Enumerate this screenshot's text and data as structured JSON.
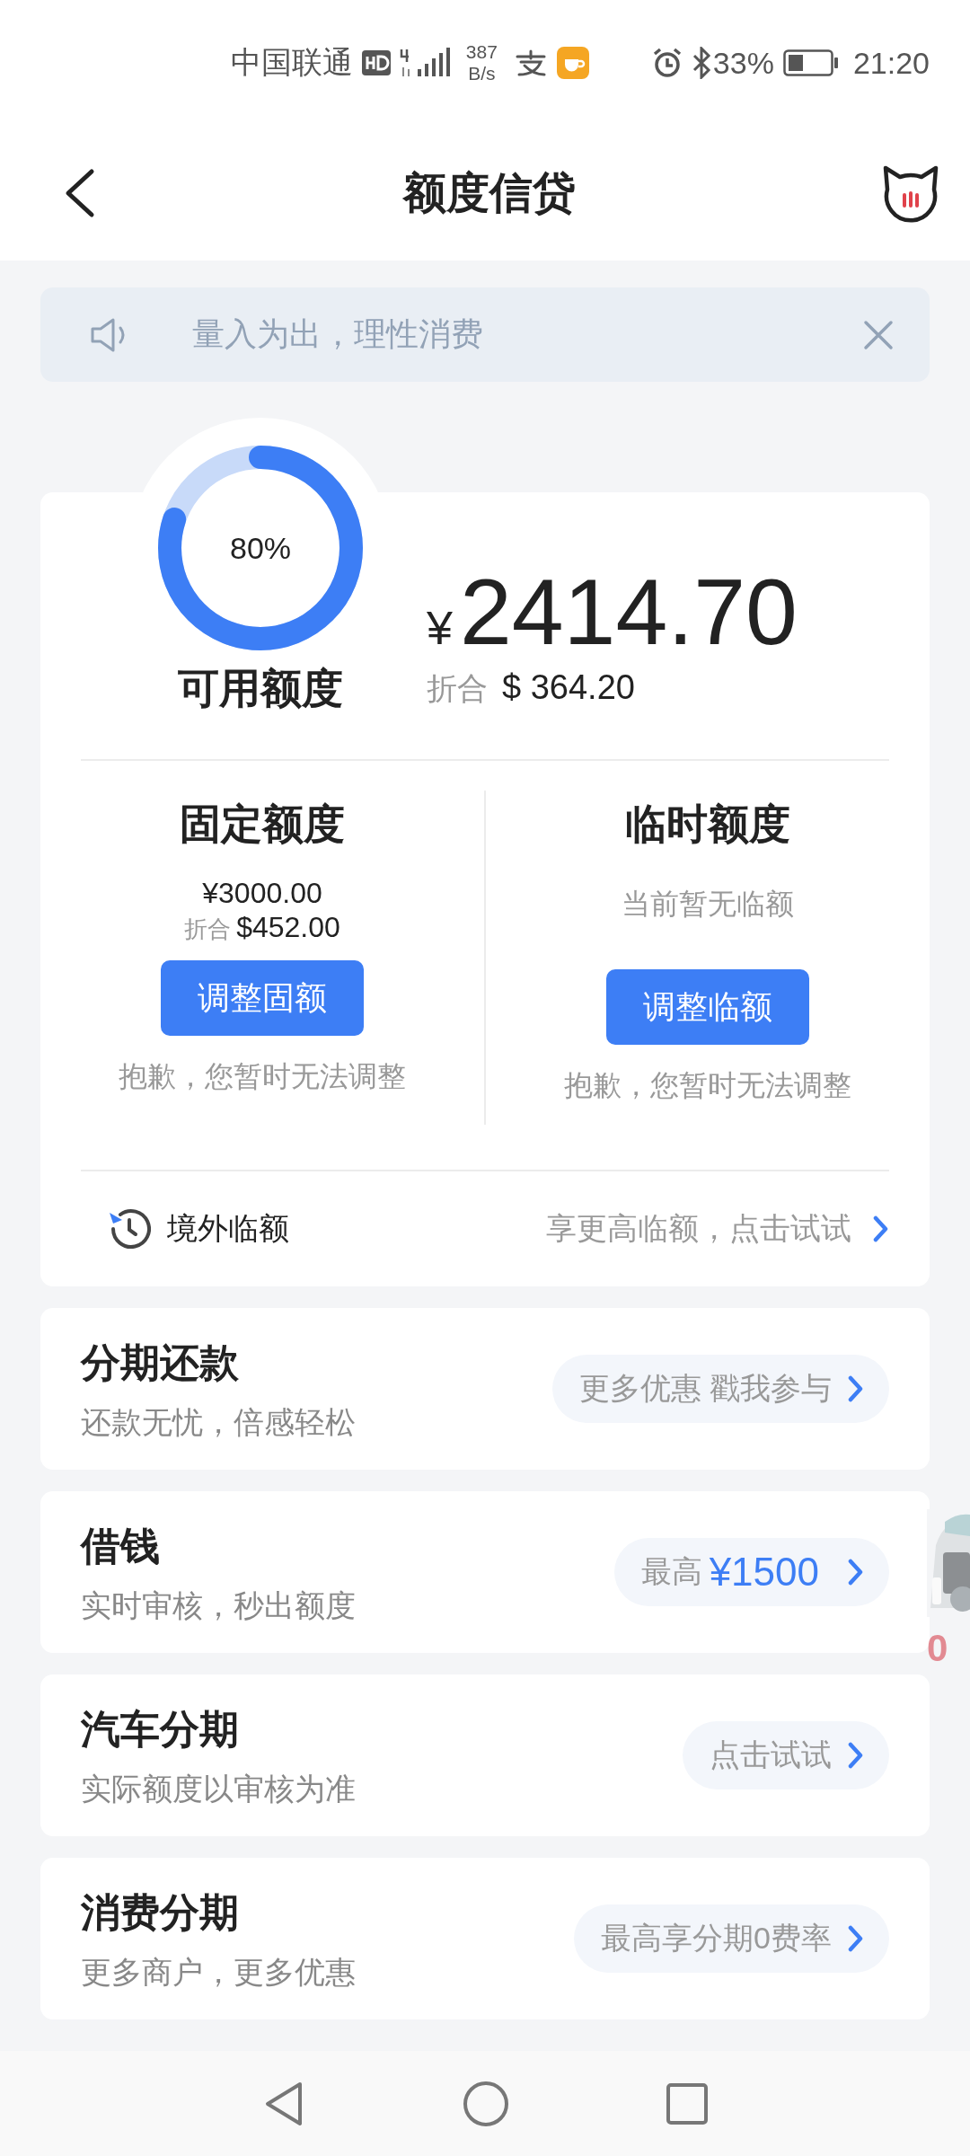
{
  "status_bar": {
    "carrier": "中国联通",
    "speed_value": "387",
    "speed_unit": "B/s",
    "battery": "33%",
    "time": "21:20"
  },
  "header": {
    "title": "额度信贷"
  },
  "notice": {
    "text": "量入为出，理性消费"
  },
  "credit": {
    "usage": "80%",
    "level": 0.8,
    "label": "可用额度",
    "currency": "¥",
    "amount": "2414.70",
    "converted_label": "折合",
    "converted_amount": "$ 364.20",
    "limits": [
      {
        "title": "固定额度",
        "amount": "¥3000.00",
        "converted_label": "折合",
        "converted_amount": "$452.00",
        "button": "调整固额",
        "note": "抱歉，您暂时无法调整"
      },
      {
        "title": "临时额度",
        "status": "当前暂无临额",
        "button": "调整临额",
        "note": "抱歉，您暂时无法调整"
      }
    ],
    "overseas": {
      "label": "境外临额",
      "action": "享更高临额，点击试试"
    }
  },
  "products": [
    {
      "title": "分期还款",
      "subtitle": "还款无忧，倍感轻松",
      "action": "更多优惠 戳我参与"
    },
    {
      "title": "借钱",
      "subtitle": "实时审核，秒出额度",
      "action": "最高",
      "action_value": "¥1500"
    },
    {
      "title": "汽车分期",
      "subtitle": "实际额度以审核为准",
      "action": "点击试试"
    },
    {
      "title": "消费分期",
      "subtitle": "更多商户，更多优惠",
      "action": "最高享分期0费率"
    }
  ],
  "floating_ad": {
    "kind": "picture",
    "text": "0"
  }
}
